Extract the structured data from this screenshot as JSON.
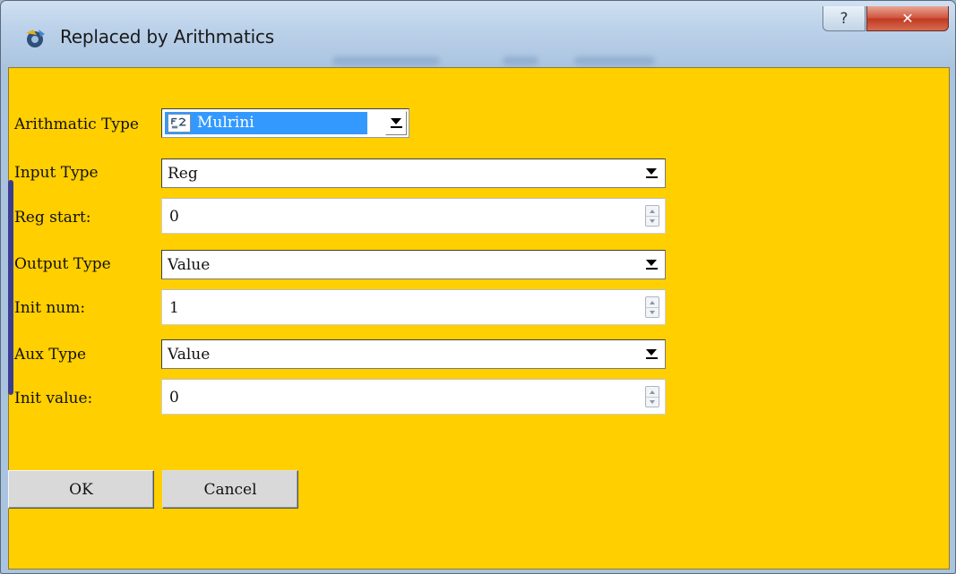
{
  "window": {
    "title": "Replaced by Arithmatics",
    "help_glyph": "?",
    "close_glyph": "✕"
  },
  "form": {
    "arithmatic_type": {
      "label": "Arithmatic Type",
      "value": "Mulrini"
    },
    "input_type": {
      "label": "Input Type",
      "value": "Reg"
    },
    "reg_start": {
      "label": "Reg start:",
      "value": "0"
    },
    "output_type": {
      "label": "Output Type",
      "value": "Value"
    },
    "init_num": {
      "label": "Init num:",
      "value": "1"
    },
    "aux_type": {
      "label": "Aux Type",
      "value": "Value"
    },
    "init_value": {
      "label": "Init value:",
      "value": "0"
    }
  },
  "buttons": {
    "ok": "OK",
    "cancel": "Cancel"
  },
  "colors": {
    "client_background": "#ffcf00",
    "selection": "#3399ff",
    "close_button": "#c94a35"
  },
  "icons": {
    "app": "app-gear-icon",
    "help": "help-icon",
    "close": "close-icon",
    "arith_item": "formula-icon"
  }
}
